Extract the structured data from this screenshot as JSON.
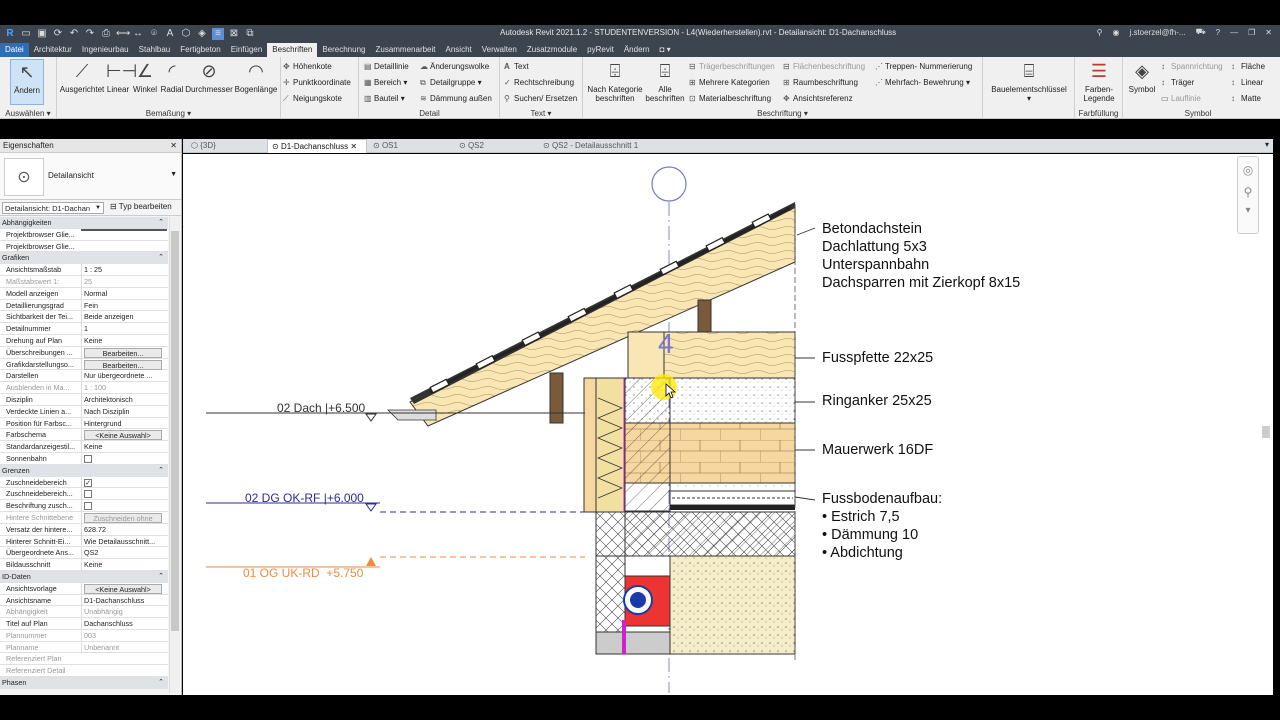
{
  "window": {
    "title": "Autodesk Revit 2021.1.2 - STUDENTENVERSION - L4(Wiederherstellen).rvt - Detailansicht: D1-Dachanschluss",
    "user": "j.stoerzel@fh-...",
    "help": "?"
  },
  "menu": {
    "tabs": [
      "Datei",
      "Architektur",
      "Ingenieurbau",
      "Stahlbau",
      "Fertigbeton",
      "Einfügen",
      "Beschriften",
      "Berechnung",
      "Zusammenarbeit",
      "Ansicht",
      "Verwalten",
      "Zusatzmodule",
      "pyRevit",
      "Ändern"
    ]
  },
  "ribbon": {
    "select": {
      "label": "Ändern",
      "group": "Auswählen"
    },
    "dimension": {
      "buttons": [
        "Ausgerichtet",
        "Linear",
        "Winkel",
        "Radial",
        "Durchmesser",
        "Bogenlänge"
      ],
      "small": [
        "Höhenkote",
        "Punktkoordinate",
        "Neigungskote"
      ],
      "group": "Bemaßung"
    },
    "detail": {
      "small": [
        "Detaillinie",
        "Bereich",
        "Bauteil",
        "Änderungswolke",
        "Detailgruppe",
        "Dämmung außen"
      ],
      "group": "Detail"
    },
    "text": {
      "small": [
        "Text",
        "Rechtschreibung",
        "Suchen/ Ersetzen"
      ],
      "group": "Text"
    },
    "tag": {
      "buttons": [
        "Nach Kategorie beschriften",
        "Alle beschriften"
      ],
      "small": [
        "Mehrere Kategorien",
        "Materialbeschriftung",
        "Trägerbeschriftungen",
        "Raumbeschriftung",
        "Ansichtsreferenz",
        "Flächenbeschriftung",
        "Treppen- Nummerierung",
        "Mehrfach- Bewehrung"
      ],
      "group": "Beschriftung"
    },
    "keynote": {
      "label": "Bauelementschlüssel"
    },
    "color": {
      "label": "Farben- Legende",
      "group": "Farbfüllung"
    },
    "symbol": {
      "label": "Symbol",
      "small": [
        "Spannrichtung",
        "Träger",
        "Lauflinie",
        "Fläche",
        "Linear",
        "Matte"
      ],
      "group": "Symbol"
    }
  },
  "doctabs": [
    "{3D}",
    "D1-Dachanschluss",
    "OS1",
    "QS2",
    "QS2 - Detailausschnitt 1"
  ],
  "properties": {
    "title": "Eigenschaften",
    "type_name": "Detailansicht",
    "selector": "Detailansicht: D1-Dachan",
    "type_edit": "Typ bearbeiten",
    "rows": [
      {
        "s": "Abhängigkeiten"
      },
      {
        "k": "Projektbrowser Glie...",
        "v": ""
      },
      {
        "k": "Projektbrowser Glie...",
        "v": ""
      },
      {
        "s": "Grafiken"
      },
      {
        "k": "Ansichtsmaßstab",
        "v": "1 : 25"
      },
      {
        "k": "Maßstabswert 1:",
        "v": "25",
        "d": true
      },
      {
        "k": "Modell anzeigen",
        "v": "Normal"
      },
      {
        "k": "Detaillierungsgrad",
        "v": "Fein"
      },
      {
        "k": "Sichtbarkeit der Tei...",
        "v": "Beide anzeigen"
      },
      {
        "k": "Detailnummer",
        "v": "1"
      },
      {
        "k": "Drehung auf Plan",
        "v": "Keine"
      },
      {
        "k": "Überschreibungen ...",
        "b": "Bearbeiten..."
      },
      {
        "k": "Grafikdarstellungso...",
        "b": "Bearbeiten..."
      },
      {
        "k": "Darstellen",
        "v": "Nur übergeordnete ..."
      },
      {
        "k": "Ausblenden in Ma...",
        "v": "1 : 100",
        "d": true
      },
      {
        "k": "Disziplin",
        "v": "Architektonisch"
      },
      {
        "k": "Verdeckte Linien a...",
        "v": "Nach Disziplin"
      },
      {
        "k": "Position für Farbsc...",
        "v": "Hintergrund"
      },
      {
        "k": "Farbschema",
        "b": "<Keine Auswahl>"
      },
      {
        "k": "Standardanzeigestil...",
        "v": "Keine"
      },
      {
        "k": "Sonnenbahn",
        "c": ""
      },
      {
        "s": "Grenzen"
      },
      {
        "k": "Zuschneidebereich",
        "c": "✓"
      },
      {
        "k": "Zuschneidebereich...",
        "c": ""
      },
      {
        "k": "Beschriftung zusch...",
        "c": ""
      },
      {
        "k": "Hintere Schnittebene",
        "b": "Zuschneiden ohne",
        "d": true
      },
      {
        "k": "Versatz der hintere...",
        "v": "628.72"
      },
      {
        "k": "Hinterer Schnitt-Ei...",
        "v": "Wie Detailausschnitt..."
      },
      {
        "k": "Übergeordnete Ans...",
        "v": "QS2"
      },
      {
        "k": "Bildausschnitt",
        "v": "Keine"
      },
      {
        "s": "ID-Daten"
      },
      {
        "k": "Ansichtsvorlage",
        "b": "<Keine Auswahl>"
      },
      {
        "k": "Ansichtsname",
        "v": "D1-Dachanschluss"
      },
      {
        "k": "Abhängigkeit",
        "v": "Unabhängig",
        "d": true
      },
      {
        "k": "Titel auf Plan",
        "v": "Dachanschluss"
      },
      {
        "k": "Plannummer",
        "v": "003",
        "d": true
      },
      {
        "k": "Planname",
        "v": "Unbenannt",
        "d": true
      },
      {
        "k": "Referenziert Plan",
        "v": "",
        "d": true
      },
      {
        "k": "Referenziert Detail",
        "v": "",
        "d": true
      },
      {
        "s": "Phasen"
      }
    ]
  },
  "drawing": {
    "grid_label": "4",
    "levels": [
      {
        "name": "02 Dach",
        "elev": "+6.500",
        "color": "#333333"
      },
      {
        "name": "02 DG OK-RF",
        "elev": "+6.000",
        "color": "#2b2b9a"
      },
      {
        "name": "01 OG UK-RD",
        "elev": "+5.750",
        "color": "#f08a3c"
      }
    ],
    "annotations": {
      "roof": [
        "Betondachstein",
        "Dachlattung 5x3",
        "Unterspannbahn",
        "Dachsparren mit Zierkopf 8x15"
      ],
      "purlin": "Fusspfette 22x25",
      "ringbeam": "Ringanker 25x25",
      "masonry": "Mauerwerk 16DF",
      "floor": [
        "Fussbodenaufbau:",
        "• Estrich 7,5",
        "• Dämmung 10",
        "• Abdichtung"
      ]
    }
  }
}
